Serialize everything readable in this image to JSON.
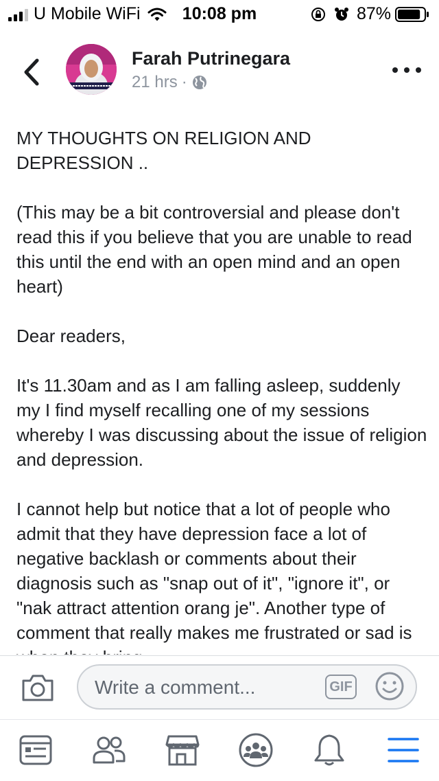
{
  "status_bar": {
    "carrier": "U Mobile WiFi",
    "time": "10:08 pm",
    "battery_percent": "87%",
    "battery_level": 0.87,
    "signal_bars_active": 3,
    "signal_bars_total": 4
  },
  "post": {
    "author": "Farah Putrinegara",
    "time_ago": "21 hrs",
    "separator": "·",
    "privacy_icon": "globe-icon",
    "avatar_caption": "FARAH PUTRINEGARA AMINO BAKRI",
    "paragraphs": [
      "MY THOUGHTS ON RELIGION AND DEPRESSION ..",
      "(This may be a bit controversial and please don't read this if you believe that you are unable to read this until the end with an open mind and an open heart)",
      "Dear readers,",
      "It's 11.30am and as I am falling asleep, suddenly my I find myself recalling one of my sessions whereby I was discussing about the issue of religion and depression.",
      "I cannot help but notice that a lot of people who admit that they have depression face a lot of negative backlash or comments about their diagnosis such as \"snap out of it\", \"ignore it\", or \"nak attract attention orang je\". Another type of comment that really makes me frustrated or sad is when they bring"
    ]
  },
  "comment_bar": {
    "placeholder": "Write a comment...",
    "gif_label": "GIF"
  },
  "tab_bar": {
    "active_tab": "menu",
    "tabs": [
      "news-feed-icon",
      "friends-icon",
      "marketplace-icon",
      "groups-icon",
      "notifications-icon",
      "menu-icon"
    ]
  },
  "colors": {
    "text": "#1c1e21",
    "secondary_text": "#8d949e",
    "brand_blue": "#1877f2",
    "icon_gray": "#606770"
  }
}
